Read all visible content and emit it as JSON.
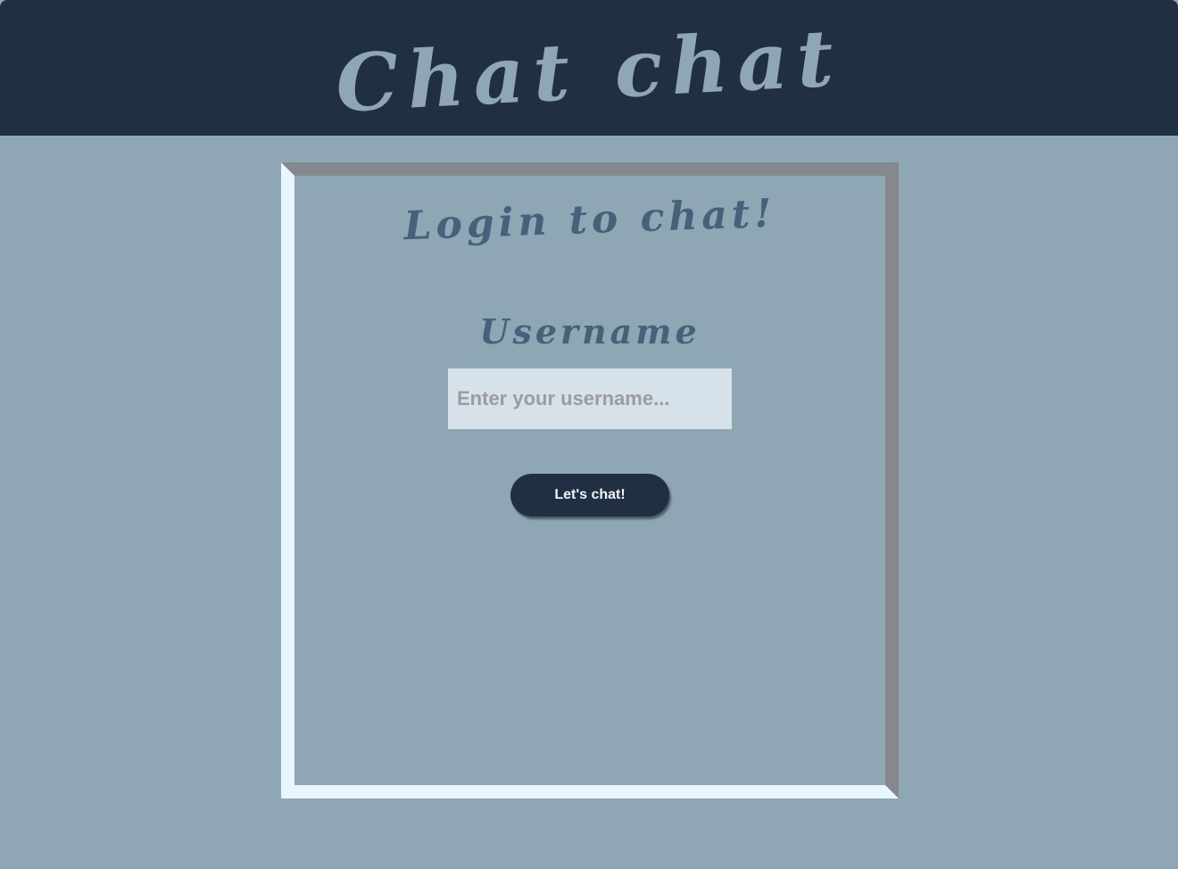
{
  "header": {
    "title": "Chat chat"
  },
  "login": {
    "heading": "Login to chat!",
    "username_label": "Username",
    "username_placeholder": "Enter your username...",
    "username_value": "",
    "submit_label": "Let's chat!"
  },
  "colors": {
    "header_bg": "#212f42",
    "page_bg": "#8fa7b5",
    "heading_text": "#46627a",
    "input_bg": "#d7e1ea",
    "button_bg": "#212f42"
  }
}
